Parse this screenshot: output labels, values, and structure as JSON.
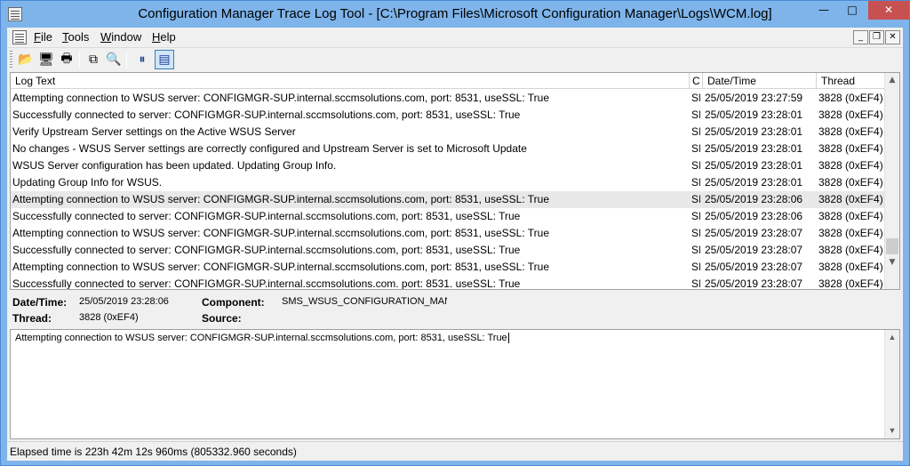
{
  "window": {
    "title": "Configuration Manager Trace Log Tool - [C:\\Program Files\\Microsoft Configuration Manager\\Logs\\WCM.log]",
    "minimize_glyph": "—",
    "maximize_glyph": "□",
    "close_glyph": "✕"
  },
  "menu": {
    "items": [
      {
        "underline": "F",
        "rest": "ile"
      },
      {
        "underline": "T",
        "rest": "ools"
      },
      {
        "underline": "W",
        "rest": "indow"
      },
      {
        "underline": "H",
        "rest": "elp"
      }
    ],
    "mdi_minimize": "_",
    "mdi_restore": "❐",
    "mdi_close": "✕"
  },
  "toolbar": {
    "buttons": [
      {
        "icon": "open-folder-icon",
        "glyph": "📂"
      },
      {
        "icon": "computer-icon",
        "glyph": "🖥"
      },
      {
        "icon": "print-icon",
        "glyph": "🖶"
      },
      {
        "icon": "copy-icon",
        "glyph": "⧉"
      },
      {
        "icon": "find-icon",
        "glyph": "🔍"
      },
      {
        "icon": "pause-icon",
        "glyph": "⏸"
      },
      {
        "icon": "details-pane-icon",
        "glyph": "▤"
      }
    ]
  },
  "grid": {
    "columns": [
      "Log Text",
      "C",
      "Date/Time",
      "Thread"
    ],
    "rows": [
      {
        "text": "Attempting connection to WSUS server: CONFIGMGR-SUP.internal.sccmsolutions.com, port: 8531, useSSL: True",
        "comp": "SI",
        "datetime": "25/05/2019 23:27:59",
        "thread": "3828 (0xEF4)"
      },
      {
        "text": "Successfully connected to server: CONFIGMGR-SUP.internal.sccmsolutions.com, port: 8531, useSSL: True",
        "comp": "SI",
        "datetime": "25/05/2019 23:28:01",
        "thread": "3828 (0xEF4)"
      },
      {
        "text": "Verify Upstream Server settings on the Active WSUS Server",
        "comp": "SI",
        "datetime": "25/05/2019 23:28:01",
        "thread": "3828 (0xEF4)"
      },
      {
        "text": "No changes - WSUS Server settings are correctly configured and Upstream Server is set to Microsoft Update",
        "comp": "SI",
        "datetime": "25/05/2019 23:28:01",
        "thread": "3828 (0xEF4)"
      },
      {
        "text": "WSUS Server configuration has been updated. Updating Group Info.",
        "comp": "SI",
        "datetime": "25/05/2019 23:28:01",
        "thread": "3828 (0xEF4)"
      },
      {
        "text": "Updating Group Info for WSUS.",
        "comp": "SI",
        "datetime": "25/05/2019 23:28:01",
        "thread": "3828 (0xEF4)"
      },
      {
        "text": "Attempting connection to WSUS server: CONFIGMGR-SUP.internal.sccmsolutions.com, port: 8531, useSSL: True",
        "comp": "SI",
        "datetime": "25/05/2019 23:28:06",
        "thread": "3828 (0xEF4)"
      },
      {
        "text": "Successfully connected to server: CONFIGMGR-SUP.internal.sccmsolutions.com, port: 8531, useSSL: True",
        "comp": "SI",
        "datetime": "25/05/2019 23:28:06",
        "thread": "3828 (0xEF4)"
      },
      {
        "text": "Attempting connection to WSUS server: CONFIGMGR-SUP.internal.sccmsolutions.com, port: 8531, useSSL: True",
        "comp": "SI",
        "datetime": "25/05/2019 23:28:07",
        "thread": "3828 (0xEF4)"
      },
      {
        "text": "Successfully connected to server: CONFIGMGR-SUP.internal.sccmsolutions.com, port: 8531, useSSL: True",
        "comp": "SI",
        "datetime": "25/05/2019 23:28:07",
        "thread": "3828 (0xEF4)"
      },
      {
        "text": "Attempting connection to WSUS server: CONFIGMGR-SUP.internal.sccmsolutions.com, port: 8531, useSSL: True",
        "comp": "SI",
        "datetime": "25/05/2019 23:28:07",
        "thread": "3828 (0xEF4)"
      },
      {
        "text": "Successfully connected to server: CONFIGMGR-SUP.internal.sccmsolutions.com. port: 8531. useSSL: True",
        "comp": "SI",
        "datetime": "25/05/2019 23:28:07",
        "thread": "3828 (0xEF4)"
      }
    ],
    "selected_index": 6,
    "scroll_up": "▲",
    "scroll_down": "▼"
  },
  "details": {
    "datetime_label": "Date/Time:",
    "datetime_value": "25/05/2019 23:28:06",
    "component_label": "Component:",
    "component_value": "SMS_WSUS_CONFIGURATION_MANAG",
    "thread_label": "Thread:",
    "thread_value": "3828 (0xEF4)",
    "source_label": "Source:",
    "source_value": ""
  },
  "message": {
    "text": "Attempting connection to WSUS server: CONFIGMGR-SUP.internal.sccmsolutions.com, port: 8531, useSSL: True"
  },
  "status": {
    "text": "Elapsed time is 223h 42m 12s 960ms (805332.960 seconds)"
  }
}
